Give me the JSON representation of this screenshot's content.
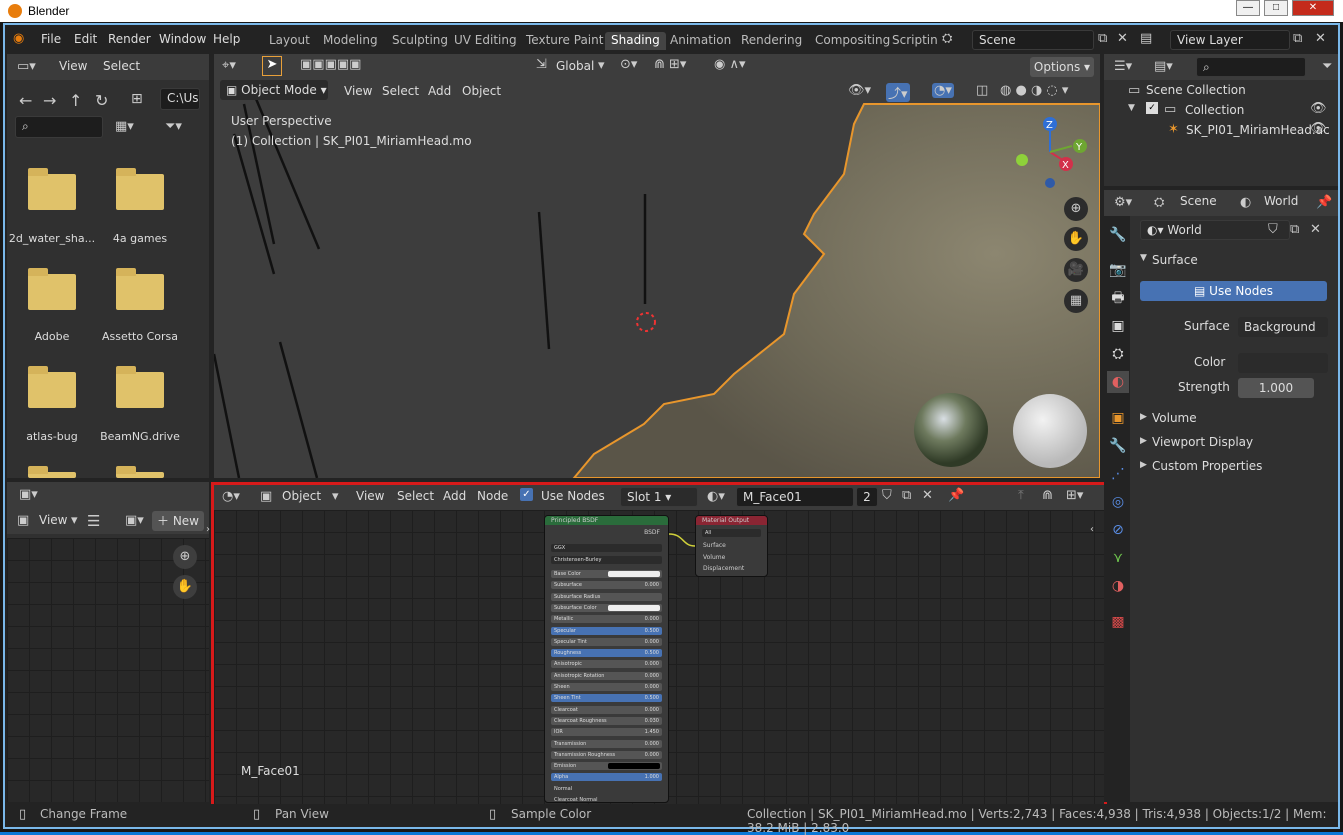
{
  "window": {
    "title": "Blender"
  },
  "menu": {
    "file": "File",
    "edit": "Edit",
    "render": "Render",
    "window": "Window",
    "help": "Help"
  },
  "workspaces": [
    "Layout",
    "Modeling",
    "Sculpting",
    "UV Editing",
    "Texture Paint",
    "Shading",
    "Animation",
    "Rendering",
    "Compositing",
    "Scriptin"
  ],
  "scene": {
    "label": "Scene",
    "view_layer": "View Layer"
  },
  "filebrowser": {
    "view": "View",
    "select": "Select",
    "path": "C:\\Us",
    "folders": [
      "2d_water_sha...",
      "4a games",
      "Adobe",
      "Assetto Corsa",
      "atlas-bug",
      "BeamNG.drive"
    ]
  },
  "image_editor": {
    "view": "View",
    "new": "New"
  },
  "viewport": {
    "mode": "Object Mode",
    "view": "View",
    "select": "Select",
    "add": "Add",
    "object": "Object",
    "transform": "Global",
    "options": "Options",
    "perspective": "User Perspective",
    "collection_info": "(1) Collection | SK_PI01_MiriamHead.mo"
  },
  "outliner": {
    "scene_collection": "Scene Collection",
    "collection": "Collection",
    "object": "SK_PI01_MiriamHead.ac"
  },
  "properties": {
    "scene_tab": "Scene",
    "world_tab": "World",
    "world_name": "World",
    "surface_panel": "Surface",
    "use_nodes": "Use Nodes",
    "surface_label": "Surface",
    "surface_value": "Background",
    "color_label": "Color",
    "strength_label": "Strength",
    "strength_value": "1.000",
    "volume": "Volume",
    "viewport_display": "Viewport Display",
    "custom_properties": "Custom Properties"
  },
  "node_editor": {
    "object": "Object",
    "view": "View",
    "select": "Select",
    "add": "Add",
    "node": "Node",
    "use_nodes": "Use Nodes",
    "slot": "Slot 1",
    "material": "M_Face01",
    "users": "2",
    "material_label": "M_Face01"
  },
  "bsdf": {
    "title": "Principled BSDF",
    "out": "BSDF",
    "dist": "GGX",
    "sss": "Christensen-Burley",
    "rows": [
      [
        "Base Color",
        ""
      ],
      [
        "Subsurface",
        "0.000"
      ],
      [
        "Subsurface Radius",
        ""
      ],
      [
        "Subsurface Color",
        ""
      ],
      [
        "Metallic",
        "0.000"
      ],
      [
        "Specular",
        "0.500"
      ],
      [
        "Specular Tint",
        "0.000"
      ],
      [
        "Roughness",
        "0.500"
      ],
      [
        "Anisotropic",
        "0.000"
      ],
      [
        "Anisotropic Rotation",
        "0.000"
      ],
      [
        "Sheen",
        "0.000"
      ],
      [
        "Sheen Tint",
        "0.500"
      ],
      [
        "Clearcoat",
        "0.000"
      ],
      [
        "Clearcoat Roughness",
        "0.030"
      ],
      [
        "IOR",
        "1.450"
      ],
      [
        "Transmission",
        "0.000"
      ],
      [
        "Transmission Roughness",
        "0.000"
      ],
      [
        "Emission",
        ""
      ],
      [
        "Alpha",
        "1.000"
      ],
      [
        "Normal",
        ""
      ],
      [
        "Clearcoat Normal",
        ""
      ]
    ]
  },
  "output_node": {
    "title": "Material Output",
    "target": "All",
    "surface": "Surface",
    "volume": "Volume",
    "displacement": "Displacement"
  },
  "status": {
    "change_frame": "Change Frame",
    "pan_view": "Pan View",
    "sample_color": "Sample Color",
    "info": "Collection | SK_PI01_MiriamHead.mo | Verts:2,743 | Faces:4,938 | Tris:4,938 | Objects:1/2 | Mem: 38.2 MiB | 2.83.0"
  }
}
